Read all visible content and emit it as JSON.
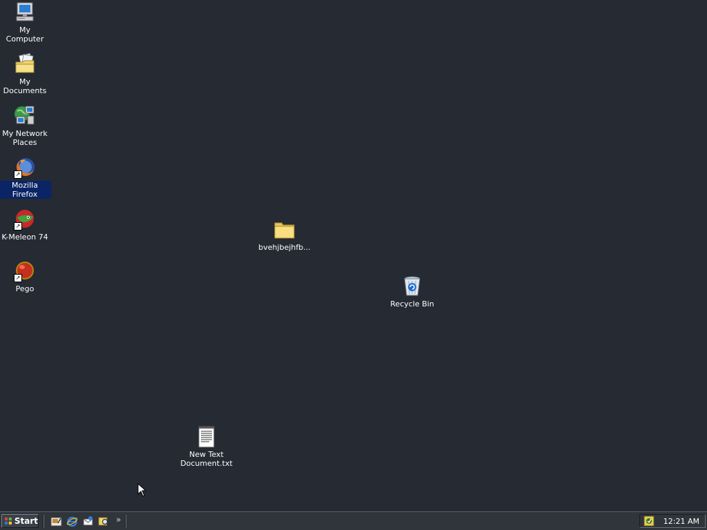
{
  "desktop": {
    "background_color": "#252a33",
    "icons": [
      {
        "label": "My Computer",
        "icon": "my-computer-icon"
      },
      {
        "label": "My Documents",
        "icon": "my-documents-icon"
      },
      {
        "label": "My Network\nPlaces",
        "icon": "network-places-icon"
      },
      {
        "label": "Mozilla Firefox",
        "icon": "firefox-icon",
        "selected": true,
        "shortcut": true
      },
      {
        "label": "K-Meleon 74",
        "icon": "k-meleon-icon",
        "shortcut": true
      },
      {
        "label": "Pego",
        "icon": "pego-icon",
        "shortcut": true
      },
      {
        "label": "bvehjbejhfb...",
        "icon": "folder-icon"
      },
      {
        "label": "Recycle Bin",
        "icon": "recycle-bin-icon"
      },
      {
        "label": "New Text\nDocument.txt",
        "icon": "text-document-icon"
      }
    ]
  },
  "taskbar": {
    "start_label": "Start",
    "quick_launch": [
      {
        "icon": "show-desktop-icon"
      },
      {
        "icon": "internet-explorer-icon"
      },
      {
        "icon": "outlook-express-icon"
      },
      {
        "icon": "search-icon"
      }
    ],
    "overflow_label": "»",
    "tray": {
      "icon": "tray-app-icon",
      "clock": "12:21 AM"
    }
  }
}
